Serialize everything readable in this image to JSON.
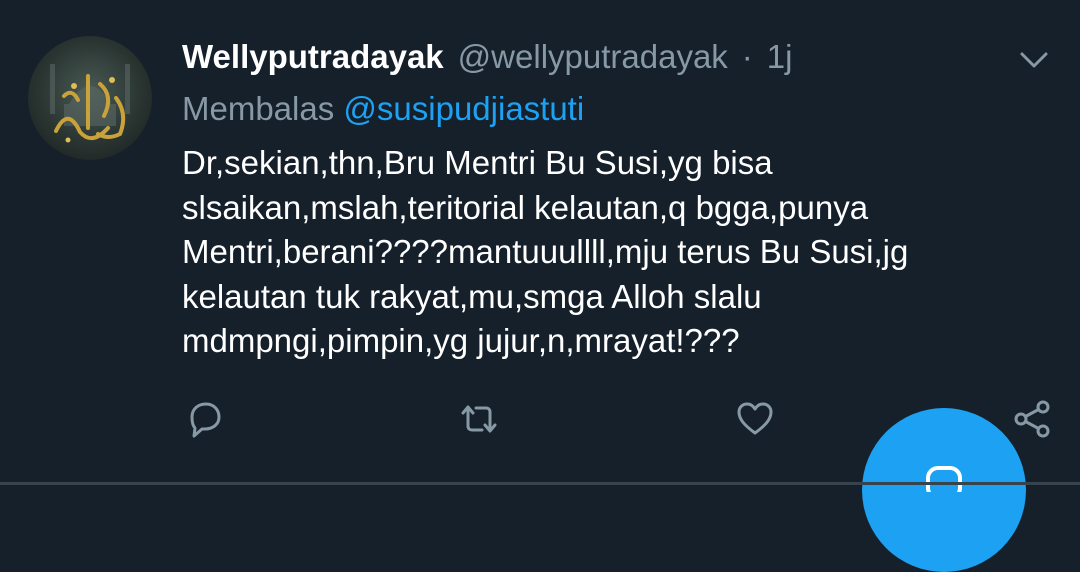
{
  "tweet": {
    "display_name": "Wellyputradayak",
    "handle": "@wellyputradayak",
    "separator": "·",
    "time": "1j",
    "reply_prefix": "Membalas",
    "reply_mention": "@susipudjiastuti",
    "text_lines": [
      "Dr,sekian,thn,Bru Mentri Bu Susi,yg bisa",
      "slsaikan,mslah,teritorial kelautan,q bgga,punya",
      "Mentri,berani????mantuuullll,mju terus Bu Susi,jg",
      "kelautan tuk rakyat,mu,smga Alloh slalu",
      "mdmpngi,pimpin,yg jujur,n,mrayat!???"
    ]
  },
  "actions": {
    "reply_icon": "reply-icon",
    "retweet_icon": "retweet-icon",
    "like_icon": "heart-icon",
    "share_icon": "share-icon",
    "menu_icon": "chevron-down-icon",
    "compose_icon": "compose-icon"
  },
  "colors": {
    "background": "#15202b",
    "text_primary": "#ffffff",
    "text_secondary": "#8899a6",
    "accent": "#1da1f2",
    "border": "#38444d"
  }
}
